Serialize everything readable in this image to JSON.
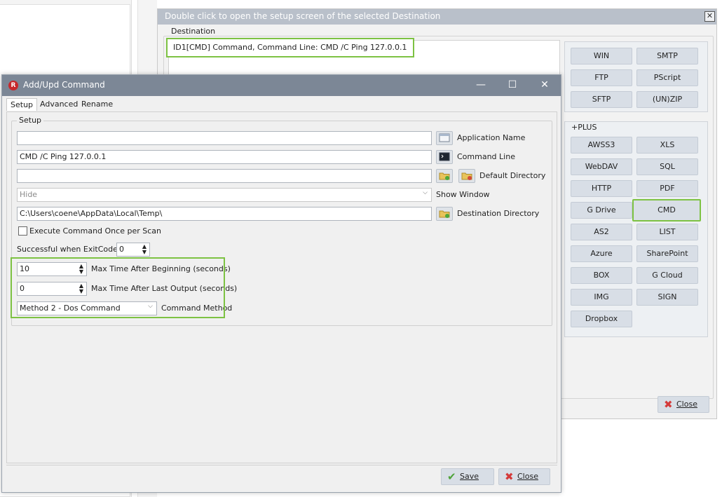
{
  "destination_window": {
    "title": "Double click to open the setup screen of the selected Destination",
    "close_x": "✕",
    "group_label": "Destination",
    "list_item": "ID1[CMD] Command, Command Line: CMD /C Ping 127.0.0.1",
    "buttons_top": [
      "WIN",
      "SMTP",
      "FTP",
      "PScript",
      "SFTP",
      "(UN)ZIP"
    ],
    "plus_label": "+PLUS",
    "buttons_plus": [
      "AWSS3",
      "XLS",
      "WebDAV",
      "SQL",
      "HTTP",
      "PDF",
      "G Drive",
      "CMD",
      "AS2",
      "LIST",
      "Azure",
      "SharePoint",
      "BOX",
      "G Cloud",
      "IMG",
      "SIGN",
      "Dropbox"
    ],
    "selected_button": "CMD",
    "close_button": "Close"
  },
  "dialog": {
    "title": "Add/Upd Command",
    "logo_letter": "R",
    "controls": {
      "minimize": "—",
      "maximize": "☐",
      "close": "✕"
    },
    "tabs": [
      "Setup",
      "Advanced",
      "Rename"
    ],
    "active_tab": "Setup",
    "group_label": "Setup",
    "fields": {
      "application_name": {
        "value": "",
        "label": "Application Name"
      },
      "command_line": {
        "value": "CMD /C Ping 127.0.0.1",
        "label": "Command Line"
      },
      "default_directory": {
        "value": "",
        "label": "Default Directory"
      },
      "show_window": {
        "value": "Hide",
        "label": "Show Window"
      },
      "destination_directory": {
        "value": "C:\\Users\\coene\\AppData\\Local\\Temp\\",
        "label": "Destination Directory"
      },
      "execute_once": {
        "label": "Execute Command Once per Scan",
        "checked": false
      },
      "exit_code": {
        "label": "Successful when ExitCode =",
        "value": "0"
      },
      "max_time_beginning": {
        "value": "10",
        "label": "Max Time After Beginning (seconds)"
      },
      "max_time_last_output": {
        "value": "0",
        "label": "Max Time After Last Output (seconds)"
      },
      "command_method": {
        "value": "Method 2 - Dos Command",
        "label": "Command Method"
      }
    },
    "save_button": "Save",
    "close_button": "Close"
  },
  "colors": {
    "highlight": "#7dc243",
    "title_bar": "#7c8796",
    "button": "#d8dee6"
  },
  "icons": [
    "close-x-icon",
    "app-logo-icon",
    "window-icon",
    "terminal-icon",
    "folder-add-icon",
    "folder-remove-icon",
    "folder-icon",
    "checkmark-icon",
    "mouse-cursor-icon"
  ]
}
